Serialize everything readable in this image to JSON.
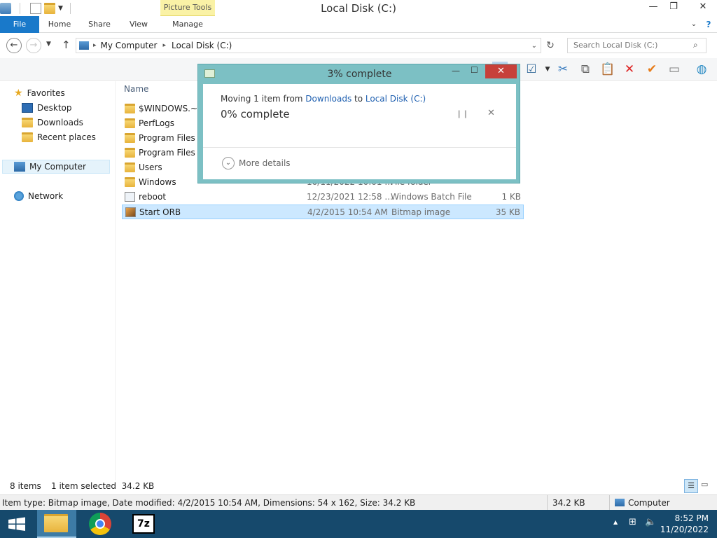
{
  "window": {
    "title": "Local Disk (C:)",
    "context_tab": "Picture Tools"
  },
  "ribbon": {
    "tabs": [
      "File",
      "Home",
      "Share",
      "View",
      "Manage"
    ]
  },
  "address": {
    "crumbs": [
      "My Computer",
      "Local Disk (C:)"
    ],
    "search_placeholder": "Search Local Disk (C:)"
  },
  "nav": {
    "favorites": "Favorites",
    "desktop": "Desktop",
    "downloads": "Downloads",
    "recent": "Recent places",
    "computer": "My Computer",
    "network": "Network"
  },
  "filelist": {
    "col_name": "Name",
    "rows": [
      {
        "name": "$WINDOWS.~BT",
        "date": "",
        "type": "",
        "size": "",
        "icon": "folder"
      },
      {
        "name": "PerfLogs",
        "date": "",
        "type": "",
        "size": "",
        "icon": "folder"
      },
      {
        "name": "Program Files",
        "date": "",
        "type": "",
        "size": "",
        "icon": "folder"
      },
      {
        "name": "Program Files (x",
        "date": "",
        "type": "",
        "size": "",
        "icon": "folder"
      },
      {
        "name": "Users",
        "date": "",
        "type": "",
        "size": "",
        "icon": "folder"
      },
      {
        "name": "Windows",
        "date": "10/11/2022 10:01 ...",
        "type": "File folder",
        "size": "",
        "icon": "folder"
      },
      {
        "name": "reboot",
        "date": "12/23/2021 12:58 ...",
        "type": "Windows Batch File",
        "size": "1 KB",
        "icon": "batch"
      },
      {
        "name": "Start ORB",
        "date": "4/2/2015 10:54 AM",
        "type": "Bitmap image",
        "size": "35 KB",
        "icon": "bitmap"
      }
    ]
  },
  "dialog": {
    "title": "3% complete",
    "moving_prefix": "Moving 1 item from ",
    "source": "Downloads",
    "to_word": " to ",
    "destination": "Local Disk (C:)",
    "progress_text": "0% complete",
    "progress_fraction": 0.03,
    "more_details": "More details"
  },
  "status": {
    "items": "8 items",
    "selected": "1 item selected  34.2 KB",
    "details": "Item type: Bitmap image, Date modified: 4/2/2015 10:54 AM, Dimensions: 54 x 162, Size: 34.2 KB",
    "size": "34.2 KB",
    "location": "Computer"
  },
  "taskbar": {
    "time": "8:52 PM",
    "date": "11/20/2022"
  },
  "colors": {
    "file_tab": "#1979ca",
    "taskbar": "#16496c",
    "selection": "#cce8ff",
    "dialog_frame": "#7cc0c4",
    "close_button": "#c7403a"
  }
}
